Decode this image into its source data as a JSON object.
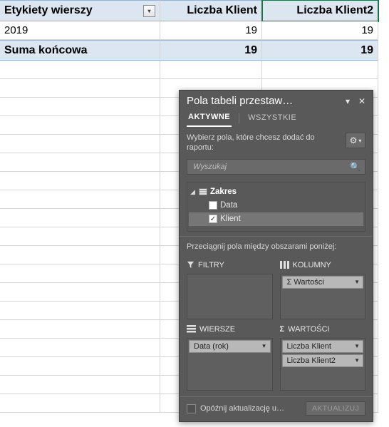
{
  "pivot": {
    "headers": {
      "rows_label": "Etykiety wierszy",
      "col1": "Liczba Klient",
      "col2": "Liczba Klient2"
    },
    "rows": [
      {
        "label": "2019",
        "v1": "19",
        "v2": "19"
      }
    ],
    "total": {
      "label": "Suma końcowa",
      "v1": "19",
      "v2": "19"
    }
  },
  "pane": {
    "title": "Pola tabeli przestaw…",
    "tabs": {
      "active": "AKTYWNE",
      "all": "WSZYSTKIE"
    },
    "choose_label": "Wybierz pola, które chcesz dodać do raportu:",
    "search_placeholder": "Wyszukaj",
    "tree": {
      "root": "Zakres",
      "items": [
        {
          "label": "Data",
          "checked": false
        },
        {
          "label": "Klient",
          "checked": true
        }
      ]
    },
    "drag_hint": "Przeciągnij pola między obszarami poniżej:",
    "areas": {
      "filters": {
        "label": "FILTRY"
      },
      "columns": {
        "label": "KOLUMNY",
        "items": [
          "Σ Wartości"
        ]
      },
      "rows": {
        "label": "WIERSZE",
        "items": [
          "Data (rok)"
        ]
      },
      "values": {
        "label": "WARTOŚCI",
        "items": [
          "Liczba Klient",
          "Liczba Klient2"
        ]
      }
    },
    "footer": {
      "defer_label": "Opóźnij aktualizację u…",
      "update_btn": "AKTUALIZUJ"
    }
  }
}
